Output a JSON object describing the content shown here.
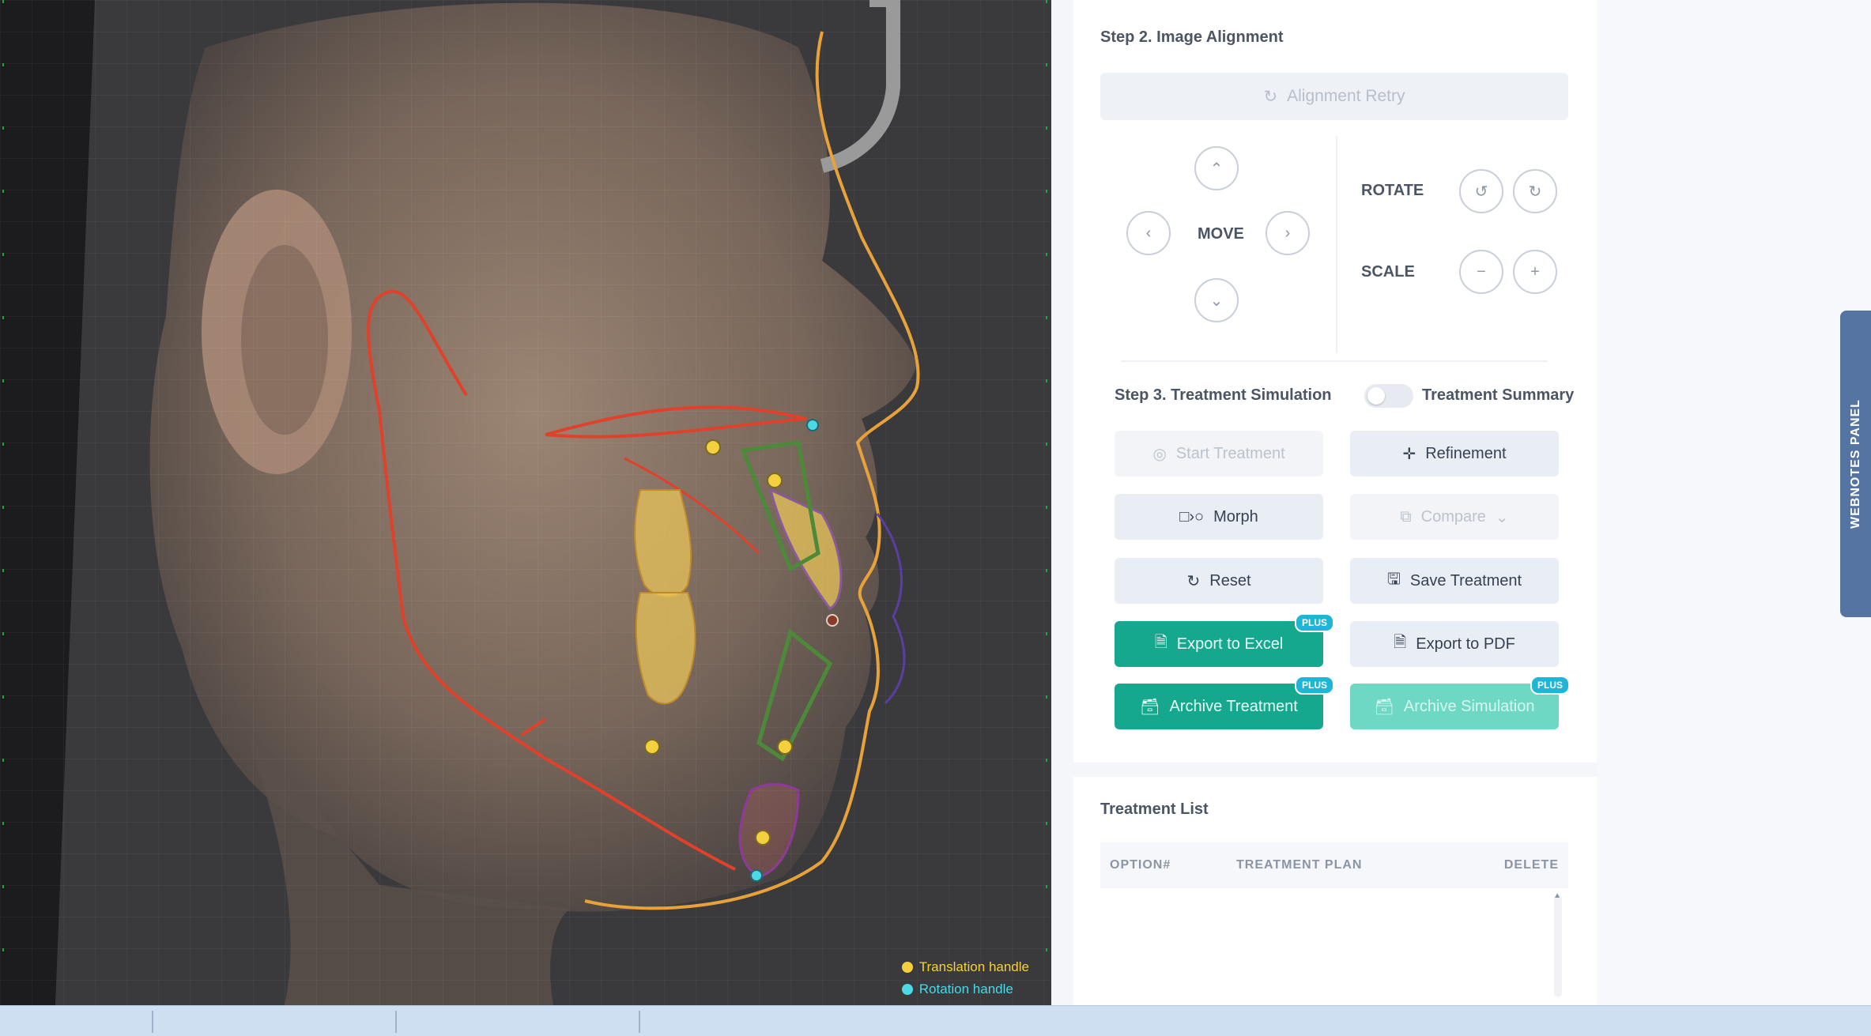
{
  "viewer": {
    "legend": {
      "translation_label": "Translation handle",
      "rotation_label": "Rotation handle",
      "translation_color": "#f4d03f",
      "rotation_color": "#4dd8e6"
    }
  },
  "step2": {
    "title": "Step 2. Image Alignment",
    "alignment_retry_label": "Alignment Retry",
    "move_label": "MOVE",
    "rotate_label": "ROTATE",
    "scale_label": "SCALE"
  },
  "step3": {
    "title": "Step 3. Treatment Simulation",
    "toggle_label": "Treatment Summary",
    "buttons": {
      "start_treatment": "Start Treatment",
      "refinement": "Refinement",
      "morph": "Morph",
      "compare": "Compare",
      "reset": "Reset",
      "save_treatment": "Save Treatment",
      "export_excel": "Export to Excel",
      "export_pdf": "Export to PDF",
      "archive_treatment": "Archive Treatment",
      "archive_simulation": "Archive Simulation"
    },
    "plus_badge": "PLUS"
  },
  "treatment_list": {
    "title": "Treatment List",
    "columns": [
      "OPTION#",
      "TREATMENT PLAN",
      "DELETE"
    ]
  },
  "webnotes": {
    "label": "WEBNOTES PANEL"
  },
  "colors": {
    "accent_green": "#15a88e",
    "badge_blue": "#1fb6d6",
    "tracing_red": "#e0412b",
    "soft_tissue_orange": "#e8a23a",
    "tooth_yellow": "#e8c45a"
  }
}
